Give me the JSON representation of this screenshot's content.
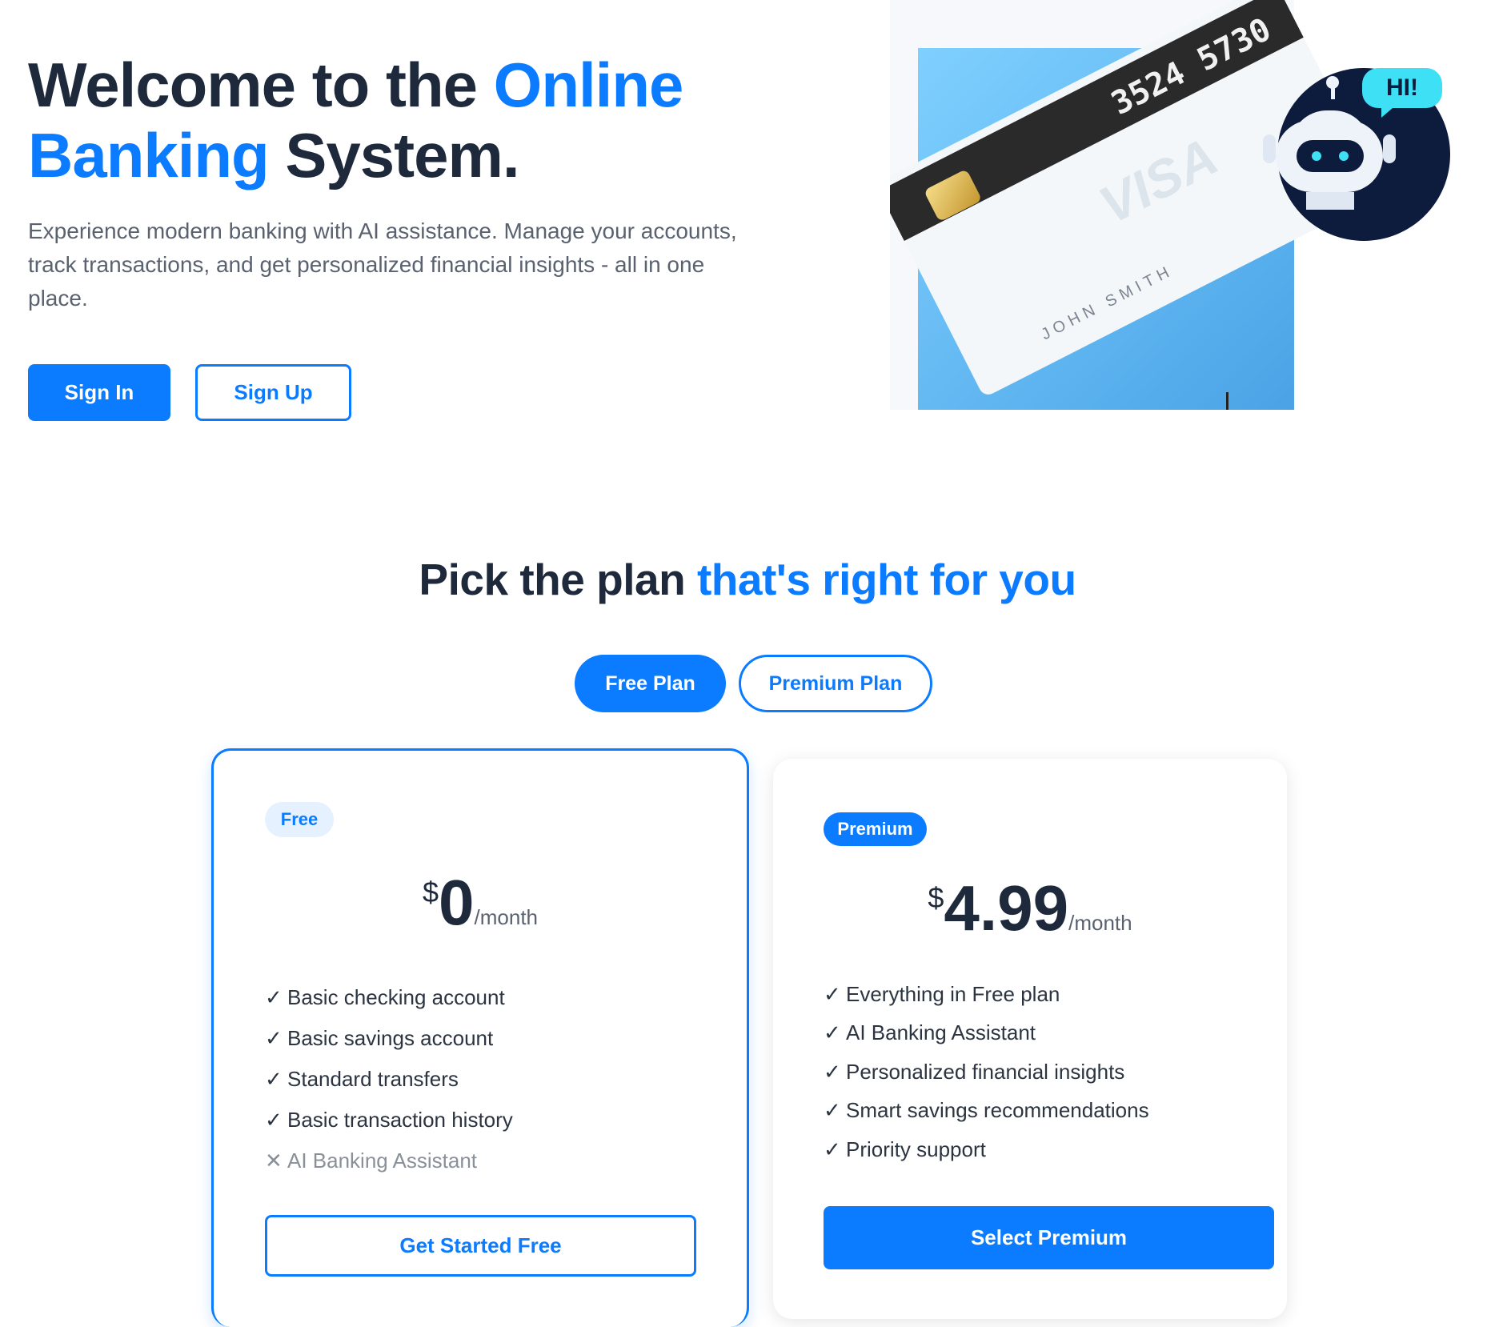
{
  "hero": {
    "title_part1": "Welcome to the ",
    "title_accent1": "Online",
    "title_accent2": "Banking",
    "title_part2": " System.",
    "subtitle": "Experience modern banking with AI assistance. Manage your accounts, track transactions, and get personalized financial insights - all in one place.",
    "signin_label": "Sign In",
    "signup_label": "Sign Up",
    "illustration": {
      "card_number": "3524 5730",
      "card_brand": "VISA",
      "card_holder": "JOHN SMITH",
      "bot_greeting": "HI!"
    }
  },
  "plans": {
    "title_part1": "Pick the plan ",
    "title_accent": "that's right for you",
    "toggle_free": "Free Plan",
    "toggle_premium": "Premium Plan",
    "free": {
      "badge": "Free",
      "currency": "$",
      "amount": "0",
      "period": "/month",
      "features": [
        {
          "mark": "✓",
          "text": "Basic checking account"
        },
        {
          "mark": "✓",
          "text": "Basic savings account"
        },
        {
          "mark": "✓",
          "text": "Standard transfers"
        },
        {
          "mark": "✓",
          "text": "Basic transaction history"
        },
        {
          "mark": "✕",
          "text": "AI Banking Assistant"
        }
      ],
      "button": "Get Started Free"
    },
    "premium": {
      "badge": "Premium",
      "currency": "$",
      "amount": "4.99",
      "period": "/month",
      "features": [
        {
          "mark": "✓",
          "text": "Everything in Free plan"
        },
        {
          "mark": "✓",
          "text": "AI Banking Assistant"
        },
        {
          "mark": "✓",
          "text": "Personalized financial insights"
        },
        {
          "mark": "✓",
          "text": "Smart savings recommendations"
        },
        {
          "mark": "✓",
          "text": "Priority support"
        }
      ],
      "button": "Select Premium"
    }
  },
  "colors": {
    "accent": "#0b7bff",
    "heading": "#1e2a3b",
    "body_text": "#5a6270",
    "card_strip": "#2a2a2a",
    "bot_navy": "#0d1b3d",
    "bot_bubble": "#3ee0f5"
  }
}
